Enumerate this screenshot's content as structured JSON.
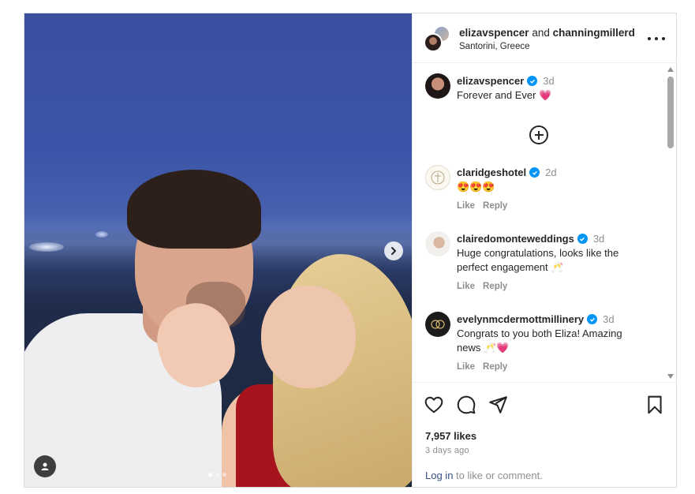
{
  "post": {
    "author": "elizavspencer",
    "and_text": "and",
    "collaborator": "channingmillerd",
    "location": "Santorini, Greece"
  },
  "comments": [
    {
      "user": "elizavspencer",
      "verified": true,
      "time": "3d",
      "text": "Forever and Ever",
      "emoji": "💗",
      "show_actions": false
    },
    {
      "user": "claridgeshotel",
      "verified": true,
      "time": "2d",
      "text": "",
      "emoji": "😍😍😍",
      "like": "Like",
      "reply": "Reply",
      "show_actions": true
    },
    {
      "user": "clairedomonteweddings",
      "verified": true,
      "time": "3d",
      "text": "Huge congratulations, looks like the perfect engagement",
      "emoji": "🥂",
      "like": "Like",
      "reply": "Reply",
      "show_actions": true
    },
    {
      "user": "evelynmcdermottmillinery",
      "verified": true,
      "time": "3d",
      "text": "Congrats to you both Eliza! Amazing news",
      "emoji": "🥂💗",
      "like": "Like",
      "reply": "Reply",
      "show_actions": true
    }
  ],
  "footer": {
    "likes": "7,957 likes",
    "ago": "3 days ago",
    "login_link": "Log in",
    "login_rest": "to like or comment."
  },
  "carousel": {
    "total_slides": 3,
    "active_slide": 1
  },
  "icons": [
    "heart-icon",
    "comment-icon",
    "share-icon",
    "bookmark-icon",
    "more-icon",
    "next-arrow-icon",
    "user-tag-icon",
    "add-icon",
    "verified-icon"
  ],
  "colors": {
    "verified": "#0095f6",
    "link": "#385185",
    "muted": "#8e8e8e",
    "text": "#262626"
  }
}
